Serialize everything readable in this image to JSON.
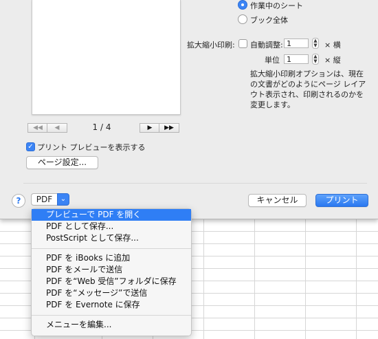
{
  "pager": {
    "first": "◀◀",
    "prev": "◀",
    "page": "1 / 4",
    "next": "▶",
    "last": "▶▶"
  },
  "options": {
    "show_preview_label": "プリント プレビューを表示する",
    "page_setup_label": "ページ設定..."
  },
  "scaling": {
    "radio_current_sheet": "作業中のシート",
    "radio_whole_book": "ブック全体",
    "label": "拡大縮小印刷:",
    "auto_label": "自動調整:",
    "auto_value": "1",
    "width_unit": "× 横",
    "unit_label": "単位",
    "unit_value": "1",
    "height_unit": "× 縦",
    "description": "拡大縮小印刷オプションは、現在の文書がどのようにページ レイアウト表示され、印刷されるのかを変更します。"
  },
  "footer": {
    "help": "?",
    "pdf_label": "PDF",
    "cancel": "キャンセル",
    "print": "プリント"
  },
  "pdf_menu": {
    "items": [
      "プレビューで PDF を開く",
      "PDF として保存...",
      "PostScript として保存...",
      "PDF を iBooks に追加",
      "PDF をメールで送信",
      "PDF を“Web 受信”フォルダに保存",
      "PDF を“メッセージ”で送信",
      "PDF を Evernote に保存",
      "メニューを編集..."
    ]
  },
  "colors": {
    "accent": "#2f7ef5",
    "dialog_bg": "#ececec"
  }
}
